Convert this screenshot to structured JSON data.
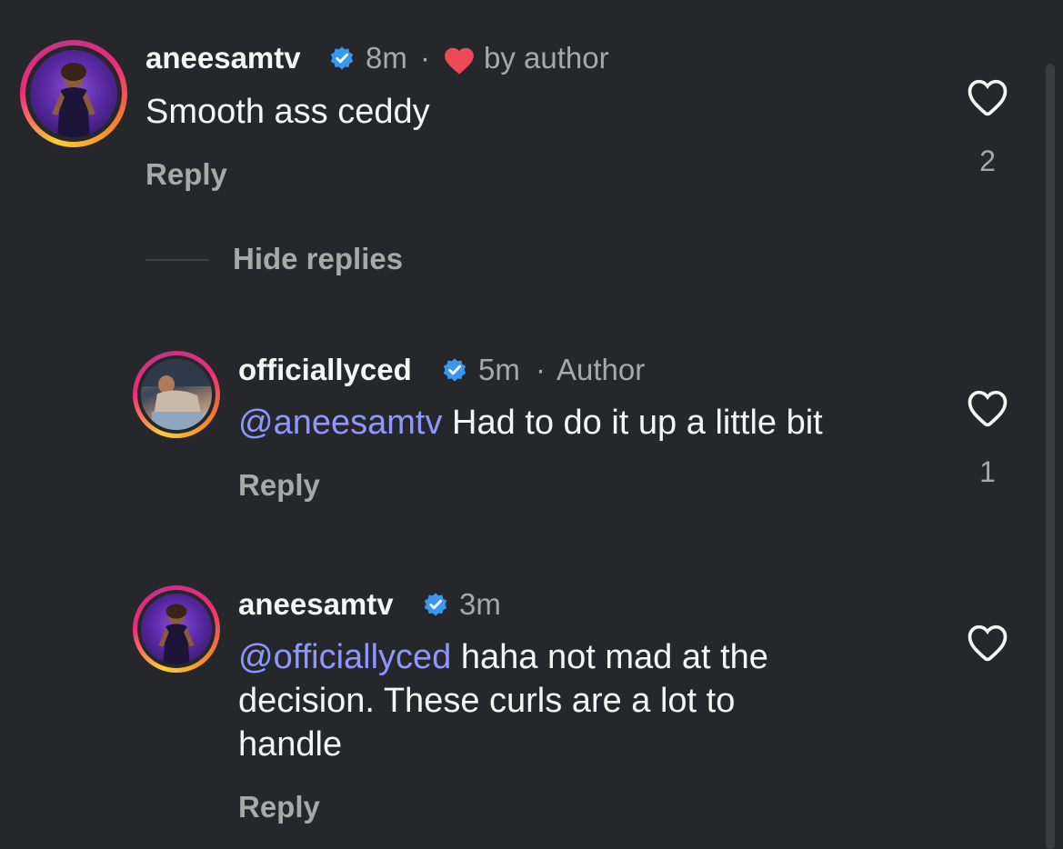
{
  "comments": [
    {
      "username": "aneesamtv",
      "time": "8m",
      "separator": "·",
      "liked_by_author_label": "by author",
      "text": "Smooth ass ceddy",
      "reply_label": "Reply",
      "like_count": "2"
    }
  ],
  "hide_replies_label": "Hide replies",
  "replies": [
    {
      "username": "officiallyced",
      "time": "5m",
      "separator": "·",
      "badge": "Author",
      "mention": "@aneesamtv",
      "text": " Had to do it up a little bit",
      "reply_label": "Reply",
      "like_count": "1"
    },
    {
      "username": "aneesamtv",
      "time": "3m",
      "mention": "@officiallyced",
      "text_line1": " haha not mad at the",
      "text_line2": "decision. These curls are a lot to",
      "text_line3": "handle",
      "reply_label": "Reply",
      "like_count": ""
    }
  ],
  "colors": {
    "background": "#25272b",
    "mention": "#8e97ff",
    "verified": "#3897f0",
    "heart_red": "#ed4956",
    "muted_text": "#a8a8a8"
  },
  "icons": [
    "verified-badge-icon",
    "heart-filled-icon",
    "heart-outline-icon"
  ]
}
